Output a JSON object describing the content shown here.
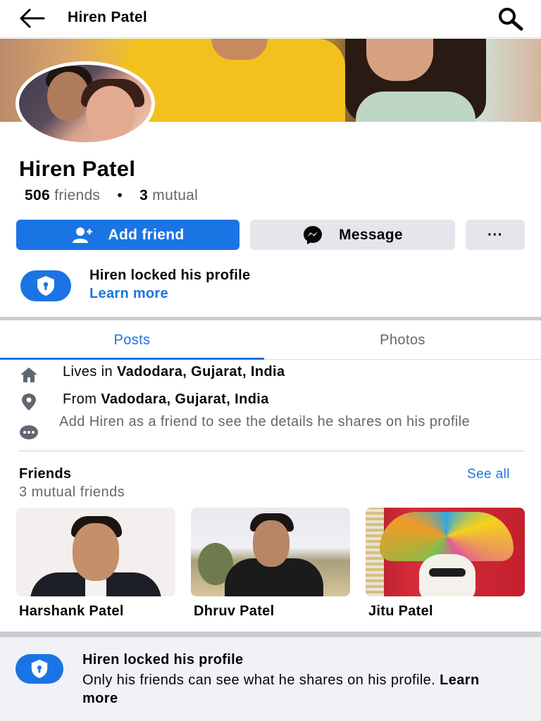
{
  "header": {
    "title": "Hiren Patel"
  },
  "profile": {
    "name": "Hiren Patel",
    "friends_count": "506",
    "friends_label": "friends",
    "mutual_count": "3",
    "mutual_label": "mutual",
    "separator": "•"
  },
  "actions": {
    "add_friend": "Add friend",
    "message": "Message",
    "more": "···"
  },
  "locked": {
    "title": "Hiren locked his profile",
    "link": "Learn more"
  },
  "tabs": [
    {
      "label": "Posts",
      "active": true
    },
    {
      "label": "Photos",
      "active": false
    }
  ],
  "intro": {
    "lives_prefix": "Lives in",
    "lives_place": "Vadodara, Gujarat, India",
    "from_prefix": "From",
    "from_place": "Vadodara, Gujarat, India",
    "more_info": "Add Hiren as a friend to see the details he shares on his profile"
  },
  "friends": {
    "title": "Friends",
    "see_all": "See all",
    "mutual": "3 mutual friends",
    "items": [
      {
        "name": "Harshank Patel"
      },
      {
        "name": "Dhruv Patel"
      },
      {
        "name": "Jitu Patel"
      }
    ]
  },
  "bottom_notice": {
    "title": "Hiren locked his profile",
    "text": "Only his friends can see what he shares on his profile.",
    "link": "Learn more"
  },
  "colors": {
    "accent": "#1b74e4",
    "muted": "#65676b",
    "button_gray": "#e4e6eb"
  }
}
